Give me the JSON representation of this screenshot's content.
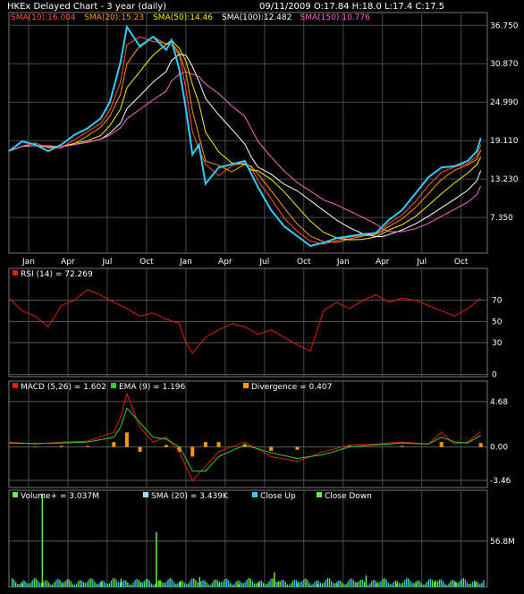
{
  "chart_data": [
    {
      "type": "line",
      "title": "HKEx  Delayed Chart - 3 year (daily)",
      "quote": {
        "date": "09/11/2009",
        "open_label": "O:17.84",
        "high_label": "H:18.0",
        "low_label": "L:17.4",
        "close_label": "C:17.5"
      },
      "ma_labels": [
        "SMA(10):16.004",
        "SMA(20):15.23",
        "SMA(50):14.46",
        "SMA(100):12.482",
        "SMA(150):10.776"
      ],
      "ma_colors": [
        "#ff5533",
        "#ff9900",
        "#ffee00",
        "#ffffff",
        "#ff66cc"
      ],
      "price_color": "#33ccff",
      "y_ticks": [
        "36.750",
        "30.870",
        "24.990",
        "19.110",
        "13.230",
        "7.350"
      ],
      "y_tick_values": [
        36.75,
        30.87,
        24.99,
        19.11,
        13.23,
        7.35
      ],
      "ylim": [
        1.9,
        38.7
      ],
      "x_ticks": [
        "Jan",
        "Apr",
        "Jul",
        "Oct",
        "Jan",
        "Apr",
        "Jul",
        "Oct",
        "Jan",
        "Apr",
        "Jul",
        "Oct"
      ],
      "x_tick_values": [
        1.5,
        4.5,
        7.5,
        10.5,
        13.5,
        16.5,
        19.5,
        22.5,
        25.5,
        28.5,
        31.5,
        34.5
      ],
      "xlim": [
        0,
        36.5
      ],
      "series": [
        {
          "x": [
            0,
            1,
            2,
            3,
            4,
            5,
            6,
            7,
            7.7,
            8.5,
            9,
            10,
            11,
            12,
            12.4,
            13,
            13.5,
            14,
            14.5,
            15,
            16,
            17,
            18,
            18.5,
            19,
            20,
            21,
            22,
            23,
            24,
            25,
            26,
            27,
            28,
            28.5,
            29,
            30,
            31,
            32,
            33,
            34,
            35,
            35.7,
            36
          ],
          "values": [
            17.5,
            19.0,
            18.5,
            17.5,
            18.5,
            20.0,
            21.0,
            22.5,
            25.0,
            31.0,
            36.5,
            33.5,
            35.0,
            33.0,
            34.5,
            30.0,
            24.0,
            17.0,
            18.5,
            12.5,
            15.0,
            15.5,
            16.0,
            14.0,
            12.0,
            8.5,
            6.0,
            4.5,
            3.0,
            3.5,
            4.2,
            4.5,
            4.8,
            5.0,
            6.0,
            7.0,
            8.5,
            11.0,
            13.5,
            15.0,
            15.2,
            16.0,
            17.5,
            19.5
          ]
        }
      ]
    },
    {
      "type": "line",
      "label": "RSI (14) = 72.269",
      "color": "#dd2200",
      "y_ticks": [
        "70",
        "50",
        "30",
        "0"
      ],
      "y_tick_values": [
        70,
        50,
        30,
        0
      ],
      "ylim": [
        -2,
        100
      ],
      "xlim": [
        0,
        36.5
      ],
      "series": [
        {
          "x": [
            0,
            1,
            2,
            3,
            4,
            5,
            6,
            7,
            8,
            9,
            10,
            11,
            12,
            13,
            13.5,
            14,
            15,
            16,
            17,
            18,
            19,
            20,
            21,
            22,
            23,
            24,
            25,
            26,
            27,
            28,
            29,
            30,
            31,
            32,
            33,
            34,
            35,
            36
          ],
          "values": [
            72,
            60,
            55,
            45,
            65,
            70,
            80,
            75,
            68,
            62,
            55,
            58,
            52,
            48,
            30,
            20,
            35,
            42,
            48,
            45,
            38,
            42,
            35,
            28,
            22,
            60,
            68,
            62,
            70,
            75,
            68,
            72,
            70,
            65,
            60,
            55,
            62,
            72
          ]
        }
      ]
    },
    {
      "type": "line",
      "labels": [
        "MACD (5,26) = 1.602",
        "EMA (9) = 1.196",
        "Divergence = 0.407"
      ],
      "colors": [
        "#dd2200",
        "#33cc33",
        "#ff9900"
      ],
      "y_ticks": [
        "4.68",
        "0.00",
        "-3.46"
      ],
      "y_tick_values": [
        4.68,
        0,
        -3.46
      ],
      "ylim": [
        -4.2,
        6.8
      ],
      "xlim": [
        0,
        36.5
      ],
      "series": [
        {
          "name": "MACD",
          "x": [
            0,
            2,
            4,
            6,
            8,
            8.5,
            9,
            10,
            11,
            12,
            13,
            13.5,
            14,
            15,
            16,
            18,
            20,
            22,
            24,
            26,
            28,
            30,
            32,
            33,
            34,
            35,
            36
          ],
          "values": [
            0.5,
            0.3,
            0.5,
            0.6,
            1.5,
            3.0,
            5.5,
            2.0,
            0.5,
            1.0,
            -0.5,
            -2.0,
            -3.5,
            -2.0,
            -0.5,
            0.5,
            -1.0,
            -1.5,
            -0.5,
            0.2,
            0.3,
            0.5,
            0.3,
            1.5,
            0.3,
            0.5,
            1.6
          ]
        },
        {
          "name": "EMA (9)",
          "x": [
            0,
            2,
            4,
            6,
            8,
            8.5,
            9,
            10,
            11,
            12,
            13,
            13.5,
            14,
            15,
            16,
            18,
            20,
            22,
            24,
            26,
            28,
            30,
            32,
            33,
            34,
            35,
            36
          ],
          "values": [
            0.4,
            0.35,
            0.4,
            0.5,
            1.0,
            2.0,
            4.0,
            2.5,
            1.0,
            0.8,
            0.0,
            -1.2,
            -2.5,
            -2.5,
            -1.0,
            0.2,
            -0.6,
            -1.2,
            -0.8,
            0.0,
            0.2,
            0.4,
            0.3,
            1.0,
            0.5,
            0.4,
            1.2
          ]
        },
        {
          "name": "Divergence",
          "x": [
            2,
            4,
            6,
            8,
            9,
            10,
            12,
            13,
            14,
            15,
            16,
            18,
            20,
            22,
            26,
            30,
            33,
            36
          ],
          "values": [
            -0.05,
            0.1,
            0.1,
            0.5,
            1.5,
            -0.5,
            0.2,
            -0.5,
            -1.0,
            0.5,
            0.5,
            0.3,
            -0.4,
            -0.3,
            0.1,
            0.1,
            0.5,
            0.4
          ]
        }
      ]
    },
    {
      "type": "bar",
      "labels": [
        "Volume+ = 3.037M",
        "SMA (20) = 3.439K",
        "Close Up",
        "Close Down"
      ],
      "colors": [
        "#66ee44",
        "#aaddff",
        "#33ccff",
        "#66ee44"
      ],
      "y_ticks": [
        "56.8M"
      ],
      "y_tick_values": [
        56.8
      ],
      "ylim": [
        0,
        120
      ],
      "xlim": [
        0,
        36.5
      ],
      "series": [
        {
          "name": "Volume",
          "x": [
            1,
            2.5,
            4,
            5.5,
            7,
            8.5,
            10,
            11.5,
            13,
            14.5,
            16,
            17.5,
            19,
            20.5,
            22,
            23.5,
            25,
            26.5,
            28,
            29.5,
            31,
            32.5,
            34,
            35.5
          ],
          "values": [
            4,
            116,
            3,
            2,
            6,
            10,
            5,
            8,
            6,
            12,
            4,
            3,
            5,
            7,
            4,
            3,
            4,
            5,
            3,
            4,
            5,
            8,
            6,
            5
          ]
        },
        {
          "name": "Spikes",
          "x": [
            11.2,
            20.2,
            27.2
          ],
          "values": [
            68,
            18,
            14
          ]
        }
      ]
    }
  ]
}
